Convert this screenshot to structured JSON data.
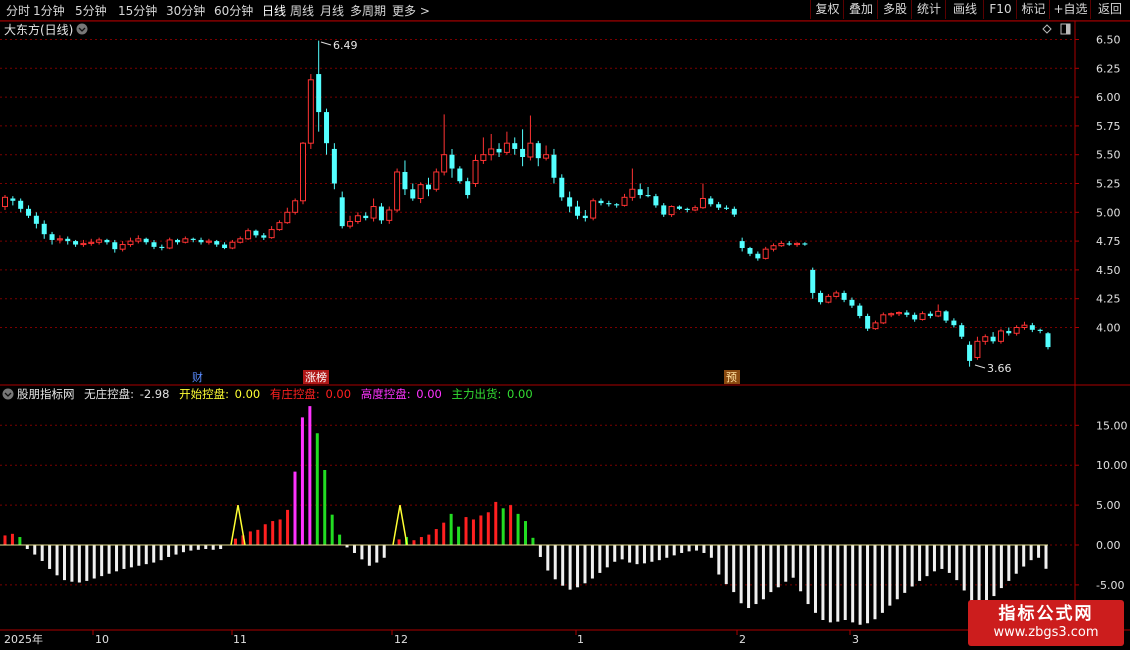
{
  "toolbar": {
    "left": [
      "分时",
      "1分钟",
      "5分钟",
      "15分钟",
      "30分钟",
      "60分钟",
      "日线",
      "周线",
      "月线",
      "多周期",
      "更多 >"
    ],
    "active": "日线",
    "right": [
      "复权",
      "叠加",
      "多股",
      "统计",
      "画线",
      "F10",
      "+自选",
      "返回"
    ],
    "mark_label": "标记"
  },
  "main_chart": {
    "title": "大东方(日线)",
    "price_ticks": [
      "6.50",
      "6.25",
      "6.00",
      "5.75",
      "5.50",
      "5.25",
      "5.00",
      "4.75",
      "4.50",
      "4.25",
      "4.00"
    ],
    "high_label": "6.49",
    "low_label": "3.66",
    "markers": {
      "cai": "财",
      "zhangbang": "涨榜",
      "yu": "预"
    }
  },
  "indicator": {
    "name": "股朋指标网",
    "values": [
      {
        "label": "无庄控盘:",
        "value": "-2.98",
        "color": "#e0e0e0"
      },
      {
        "label": "开始控盘:",
        "value": "0.00",
        "color": "#ffff33"
      },
      {
        "label": "有庄控盘:",
        "value": "0.00",
        "color": "#ff2020"
      },
      {
        "label": "高度控盘:",
        "value": "0.00",
        "color": "#ff33ff"
      },
      {
        "label": "主力出货:",
        "value": "0.00",
        "color": "#33dd33"
      }
    ],
    "y_ticks": [
      "15.00",
      "10.00",
      "5.00",
      "0.00",
      "-5.00"
    ]
  },
  "time_axis": {
    "labels": [
      "2025年",
      "10",
      "11",
      "12",
      "1",
      "2",
      "3"
    ]
  },
  "watermark": {
    "title": "指标公式网",
    "url": "www.zbgs3.com"
  },
  "colors": {
    "up": "#ff3333",
    "down": "#54ffff",
    "grid": "#7a0000",
    "border": "#aa0000"
  },
  "chart_data": {
    "type": "candlestick",
    "candles": [
      [
        5.05,
        5.13,
        5.15,
        5.02
      ],
      [
        5.12,
        5.1,
        5.14,
        5.06
      ],
      [
        5.1,
        5.03,
        5.12,
        5.0
      ],
      [
        5.03,
        4.97,
        5.06,
        4.95
      ],
      [
        4.97,
        4.9,
        5.0,
        4.86
      ],
      [
        4.9,
        4.81,
        4.93,
        4.77
      ],
      [
        4.81,
        4.76,
        4.83,
        4.72
      ],
      [
        4.76,
        4.77,
        4.8,
        4.73
      ],
      [
        4.77,
        4.75,
        4.79,
        4.72
      ],
      [
        4.75,
        4.72,
        4.76,
        4.7
      ],
      [
        4.72,
        4.73,
        4.76,
        4.7
      ],
      [
        4.73,
        4.74,
        4.77,
        4.71
      ],
      [
        4.74,
        4.76,
        4.78,
        4.72
      ],
      [
        4.76,
        4.74,
        4.77,
        4.72
      ],
      [
        4.74,
        4.68,
        4.76,
        4.65
      ],
      [
        4.68,
        4.72,
        4.75,
        4.66
      ],
      [
        4.72,
        4.75,
        4.78,
        4.7
      ],
      [
        4.75,
        4.77,
        4.8,
        4.73
      ],
      [
        4.77,
        4.74,
        4.78,
        4.72
      ],
      [
        4.74,
        4.7,
        4.76,
        4.68
      ],
      [
        4.7,
        4.69,
        4.72,
        4.67
      ],
      [
        4.69,
        4.76,
        4.78,
        4.68
      ],
      [
        4.76,
        4.74,
        4.77,
        4.72
      ],
      [
        4.74,
        4.77,
        4.79,
        4.73
      ],
      [
        4.77,
        4.76,
        4.78,
        4.74
      ],
      [
        4.76,
        4.74,
        4.78,
        4.72
      ],
      [
        4.74,
        4.75,
        4.77,
        4.72
      ],
      [
        4.75,
        4.72,
        4.76,
        4.7
      ],
      [
        4.72,
        4.69,
        4.74,
        4.68
      ],
      [
        4.69,
        4.74,
        4.76,
        4.68
      ],
      [
        4.74,
        4.77,
        4.79,
        4.73
      ],
      [
        4.77,
        4.84,
        4.86,
        4.76
      ],
      [
        4.84,
        4.8,
        4.85,
        4.78
      ],
      [
        4.8,
        4.78,
        4.82,
        4.76
      ],
      [
        4.78,
        4.85,
        4.88,
        4.77
      ],
      [
        4.85,
        4.91,
        4.93,
        4.84
      ],
      [
        4.91,
        5.0,
        5.04,
        4.9
      ],
      [
        5.0,
        5.1,
        5.12,
        4.98
      ],
      [
        5.1,
        5.6,
        5.61,
        5.07
      ],
      [
        5.6,
        6.15,
        6.2,
        5.55
      ],
      [
        6.2,
        5.87,
        6.49,
        5.7
      ],
      [
        5.87,
        5.6,
        5.9,
        5.5
      ],
      [
        5.55,
        5.25,
        5.6,
        5.2
      ],
      [
        5.13,
        4.88,
        5.18,
        4.86
      ],
      [
        4.88,
        4.92,
        4.97,
        4.86
      ],
      [
        4.92,
        4.97,
        5.0,
        4.9
      ],
      [
        4.97,
        4.95,
        5.0,
        4.93
      ],
      [
        4.95,
        5.05,
        5.12,
        4.92
      ],
      [
        5.05,
        4.93,
        5.08,
        4.9
      ],
      [
        4.93,
        5.02,
        5.05,
        4.9
      ],
      [
        5.02,
        5.35,
        5.38,
        5.0
      ],
      [
        5.35,
        5.2,
        5.45,
        5.15
      ],
      [
        5.2,
        5.12,
        5.25,
        5.1
      ],
      [
        5.12,
        5.24,
        5.26,
        5.08
      ],
      [
        5.24,
        5.2,
        5.3,
        5.14
      ],
      [
        5.2,
        5.35,
        5.38,
        5.18
      ],
      [
        5.35,
        5.5,
        5.85,
        5.32
      ],
      [
        5.5,
        5.38,
        5.55,
        5.3
      ],
      [
        5.38,
        5.27,
        5.4,
        5.25
      ],
      [
        5.27,
        5.15,
        5.3,
        5.12
      ],
      [
        5.25,
        5.45,
        5.5,
        5.22
      ],
      [
        5.45,
        5.5,
        5.65,
        5.42
      ],
      [
        5.5,
        5.55,
        5.68,
        5.45
      ],
      [
        5.55,
        5.52,
        5.6,
        5.48
      ],
      [
        5.52,
        5.6,
        5.7,
        5.5
      ],
      [
        5.6,
        5.55,
        5.65,
        5.5
      ],
      [
        5.55,
        5.48,
        5.72,
        5.4
      ],
      [
        5.48,
        5.6,
        5.84,
        5.45
      ],
      [
        5.6,
        5.47,
        5.62,
        5.4
      ],
      [
        5.47,
        5.5,
        5.58,
        5.45
      ],
      [
        5.5,
        5.3,
        5.55,
        5.25
      ],
      [
        5.3,
        5.13,
        5.33,
        5.1
      ],
      [
        5.13,
        5.05,
        5.18,
        5.0
      ],
      [
        5.05,
        4.97,
        5.1,
        4.94
      ],
      [
        4.97,
        4.95,
        5.02,
        4.92
      ],
      [
        4.95,
        5.1,
        5.12,
        4.93
      ],
      [
        5.1,
        5.08,
        5.12,
        5.06
      ],
      [
        5.08,
        5.07,
        5.1,
        5.05
      ],
      [
        5.07,
        5.06,
        5.08,
        5.04
      ],
      [
        5.06,
        5.13,
        5.16,
        5.05
      ],
      [
        5.13,
        5.2,
        5.38,
        5.1
      ],
      [
        5.2,
        5.15,
        5.25,
        5.12
      ],
      [
        5.15,
        5.14,
        5.22,
        5.13
      ],
      [
        5.14,
        5.06,
        5.16,
        5.04
      ],
      [
        5.06,
        4.98,
        5.08,
        4.96
      ],
      [
        4.98,
        5.05,
        5.06,
        4.96
      ],
      [
        5.05,
        5.03,
        5.06,
        5.02
      ],
      [
        5.03,
        5.02,
        5.04,
        5.0
      ],
      [
        5.02,
        5.04,
        5.06,
        5.01
      ],
      [
        5.04,
        5.12,
        5.25,
        5.03
      ],
      [
        5.12,
        5.07,
        5.14,
        5.05
      ],
      [
        5.07,
        5.04,
        5.09,
        5.02
      ],
      [
        5.04,
        5.03,
        5.06,
        5.02
      ],
      [
        5.03,
        4.98,
        5.05,
        4.96
      ],
      [
        4.75,
        4.69,
        4.78,
        4.66
      ],
      [
        4.69,
        4.64,
        4.7,
        4.62
      ],
      [
        4.64,
        4.6,
        4.66,
        4.58
      ],
      [
        4.6,
        4.68,
        4.7,
        4.59
      ],
      [
        4.68,
        4.71,
        4.73,
        4.66
      ],
      [
        4.71,
        4.73,
        4.75,
        4.7
      ],
      [
        4.73,
        4.72,
        4.75,
        4.71
      ],
      [
        4.72,
        4.73,
        4.74,
        4.7
      ],
      [
        4.73,
        4.72,
        4.74,
        4.71
      ],
      [
        4.5,
        4.3,
        4.52,
        4.25
      ],
      [
        4.3,
        4.22,
        4.32,
        4.2
      ],
      [
        4.22,
        4.27,
        4.29,
        4.21
      ],
      [
        4.27,
        4.3,
        4.32,
        4.26
      ],
      [
        4.3,
        4.24,
        4.32,
        4.22
      ],
      [
        4.24,
        4.19,
        4.26,
        4.17
      ],
      [
        4.19,
        4.1,
        4.21,
        4.08
      ],
      [
        4.1,
        3.99,
        4.12,
        3.97
      ],
      [
        3.99,
        4.04,
        4.06,
        3.98
      ],
      [
        4.04,
        4.11,
        4.13,
        4.03
      ],
      [
        4.11,
        4.12,
        4.13,
        4.09
      ],
      [
        4.12,
        4.13,
        4.14,
        4.1
      ],
      [
        4.13,
        4.11,
        4.15,
        4.09
      ],
      [
        4.11,
        4.07,
        4.13,
        4.05
      ],
      [
        4.07,
        4.12,
        4.14,
        4.06
      ],
      [
        4.12,
        4.1,
        4.14,
        4.08
      ],
      [
        4.1,
        4.14,
        4.2,
        4.09
      ],
      [
        4.14,
        4.06,
        4.15,
        4.04
      ],
      [
        4.06,
        4.02,
        4.08,
        4.0
      ],
      [
        4.02,
        3.92,
        4.04,
        3.9
      ],
      [
        3.85,
        3.71,
        3.88,
        3.66
      ],
      [
        3.74,
        3.88,
        3.92,
        3.72
      ],
      [
        3.88,
        3.92,
        3.94,
        3.85
      ],
      [
        3.92,
        3.88,
        3.96,
        3.86
      ],
      [
        3.88,
        3.97,
        3.99,
        3.86
      ],
      [
        3.97,
        3.95,
        4.0,
        3.93
      ],
      [
        3.95,
        4.0,
        4.02,
        3.93
      ],
      [
        4.0,
        4.02,
        4.05,
        3.98
      ],
      [
        4.02,
        3.98,
        4.04,
        3.96
      ],
      [
        3.98,
        3.97,
        3.99,
        3.95
      ],
      [
        3.95,
        3.83,
        3.96,
        3.81
      ]
    ],
    "indicator_bars": [
      [
        1.2,
        "r"
      ],
      [
        1.4,
        "r"
      ],
      [
        1.0,
        "g"
      ],
      [
        -0.5,
        "w"
      ],
      [
        -1.2,
        "w"
      ],
      [
        -2.0,
        "w"
      ],
      [
        -3.0,
        "w"
      ],
      [
        -3.8,
        "w"
      ],
      [
        -4.4,
        "w"
      ],
      [
        -4.6,
        "w"
      ],
      [
        -4.7,
        "w"
      ],
      [
        -4.5,
        "w"
      ],
      [
        -4.2,
        "w"
      ],
      [
        -3.9,
        "w"
      ],
      [
        -3.6,
        "w"
      ],
      [
        -3.3,
        "w"
      ],
      [
        -3.0,
        "w"
      ],
      [
        -2.8,
        "w"
      ],
      [
        -2.6,
        "w"
      ],
      [
        -2.4,
        "w"
      ],
      [
        -2.2,
        "w"
      ],
      [
        -1.9,
        "w"
      ],
      [
        -1.5,
        "w"
      ],
      [
        -1.2,
        "w"
      ],
      [
        -0.9,
        "w"
      ],
      [
        -0.7,
        "w"
      ],
      [
        -0.6,
        "w"
      ],
      [
        -0.5,
        "w"
      ],
      [
        -0.6,
        "w"
      ],
      [
        -0.5,
        "w"
      ],
      [
        0,
        "w"
      ],
      [
        0.8,
        "r"
      ],
      [
        1.2,
        "r"
      ],
      [
        1.7,
        "r"
      ],
      [
        1.9,
        "r"
      ],
      [
        2.6,
        "r"
      ],
      [
        3.0,
        "r"
      ],
      [
        3.2,
        "r"
      ],
      [
        4.4,
        "r"
      ],
      [
        9.2,
        "m"
      ],
      [
        16.0,
        "m"
      ],
      [
        17.4,
        "m"
      ],
      [
        14.0,
        "g"
      ],
      [
        9.4,
        "g"
      ],
      [
        3.8,
        "g"
      ],
      [
        1.3,
        "g"
      ],
      [
        -0.3,
        "w"
      ],
      [
        -1.0,
        "w"
      ],
      [
        -1.8,
        "w"
      ],
      [
        -2.6,
        "w"
      ],
      [
        -2.2,
        "w"
      ],
      [
        -1.6,
        "w"
      ],
      [
        0,
        "w"
      ],
      [
        0.7,
        "r"
      ],
      [
        1.0,
        "g"
      ],
      [
        0.6,
        "r"
      ],
      [
        1.0,
        "r"
      ],
      [
        1.3,
        "r"
      ],
      [
        2.0,
        "r"
      ],
      [
        2.8,
        "r"
      ],
      [
        3.9,
        "g"
      ],
      [
        2.3,
        "g"
      ],
      [
        3.5,
        "r"
      ],
      [
        3.2,
        "r"
      ],
      [
        3.7,
        "r"
      ],
      [
        4.1,
        "r"
      ],
      [
        5.4,
        "r"
      ],
      [
        4.6,
        "g"
      ],
      [
        5.0,
        "r"
      ],
      [
        3.9,
        "g"
      ],
      [
        3.0,
        "g"
      ],
      [
        0.9,
        "g"
      ],
      [
        -1.5,
        "w"
      ],
      [
        -3.2,
        "w"
      ],
      [
        -4.3,
        "w"
      ],
      [
        -5.1,
        "w"
      ],
      [
        -5.6,
        "w"
      ],
      [
        -5.3,
        "w"
      ],
      [
        -4.8,
        "w"
      ],
      [
        -4.2,
        "w"
      ],
      [
        -3.5,
        "w"
      ],
      [
        -2.8,
        "w"
      ],
      [
        -2.1,
        "w"
      ],
      [
        -1.8,
        "w"
      ],
      [
        -2.2,
        "w"
      ],
      [
        -2.4,
        "w"
      ],
      [
        -2.3,
        "w"
      ],
      [
        -2.1,
        "w"
      ],
      [
        -1.9,
        "w"
      ],
      [
        -1.6,
        "w"
      ],
      [
        -1.3,
        "w"
      ],
      [
        -1.0,
        "w"
      ],
      [
        -0.8,
        "w"
      ],
      [
        -0.7,
        "w"
      ],
      [
        -1.0,
        "w"
      ],
      [
        -1.6,
        "w"
      ],
      [
        -3.7,
        "w"
      ],
      [
        -4.9,
        "w"
      ],
      [
        -5.9,
        "w"
      ],
      [
        -7.3,
        "w"
      ],
      [
        -7.9,
        "w"
      ],
      [
        -7.4,
        "w"
      ],
      [
        -6.8,
        "w"
      ],
      [
        -5.9,
        "w"
      ],
      [
        -5.3,
        "w"
      ],
      [
        -4.6,
        "w"
      ],
      [
        -4.1,
        "w"
      ],
      [
        -5.8,
        "w"
      ],
      [
        -7.4,
        "w"
      ],
      [
        -8.5,
        "w"
      ],
      [
        -9.4,
        "w"
      ],
      [
        -9.7,
        "w"
      ],
      [
        -9.6,
        "w"
      ],
      [
        -9.4,
        "w"
      ],
      [
        -9.7,
        "w"
      ],
      [
        -10.0,
        "w"
      ],
      [
        -9.8,
        "w"
      ],
      [
        -9.3,
        "w"
      ],
      [
        -8.5,
        "w"
      ],
      [
        -7.6,
        "w"
      ],
      [
        -6.8,
        "w"
      ],
      [
        -6.0,
        "w"
      ],
      [
        -5.2,
        "w"
      ],
      [
        -4.5,
        "w"
      ],
      [
        -3.9,
        "w"
      ],
      [
        -3.3,
        "w"
      ],
      [
        -3.0,
        "w"
      ],
      [
        -3.5,
        "w"
      ],
      [
        -4.4,
        "w"
      ],
      [
        -5.7,
        "w"
      ],
      [
        -7.3,
        "w"
      ],
      [
        -7.6,
        "w"
      ],
      [
        -7.2,
        "w"
      ],
      [
        -6.4,
        "w"
      ],
      [
        -5.4,
        "w"
      ],
      [
        -4.5,
        "w"
      ],
      [
        -3.6,
        "w"
      ],
      [
        -2.7,
        "w"
      ],
      [
        -1.9,
        "w"
      ],
      [
        -1.6,
        "w"
      ],
      [
        -2.98,
        "w"
      ]
    ],
    "price_range": [
      3.6,
      6.55
    ],
    "indicator_range": [
      -10.5,
      18.5
    ]
  }
}
